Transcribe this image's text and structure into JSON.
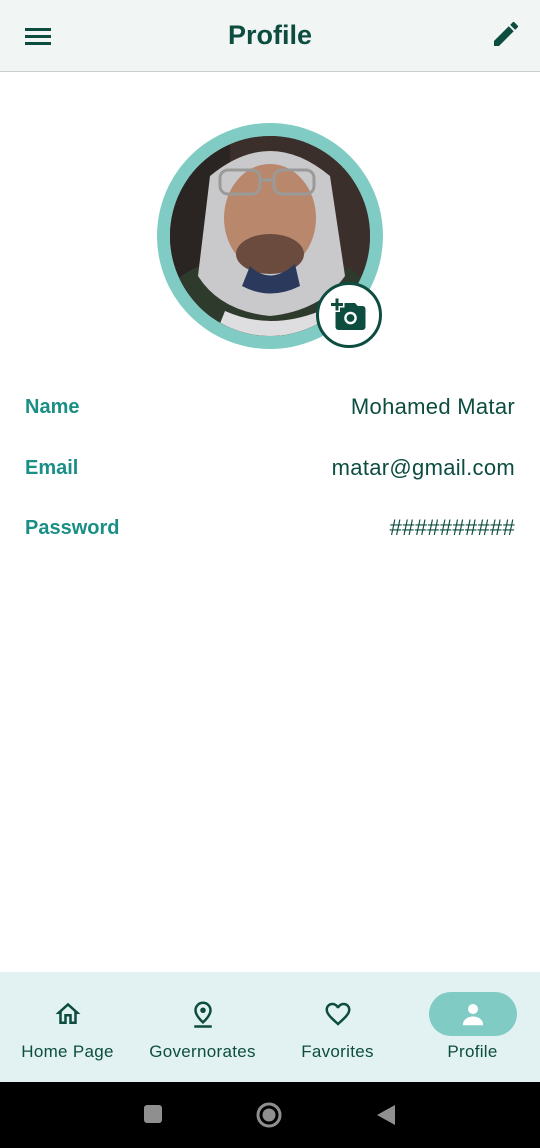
{
  "header": {
    "title": "Profile",
    "menu_icon": "menu-icon",
    "edit_icon": "pencil-icon"
  },
  "profile": {
    "avatar_icon": "avatar-photo",
    "camera_icon": "add-photo-camera-icon",
    "fields": [
      {
        "label": "Name",
        "value": "Mohamed Matar"
      },
      {
        "label": "Email",
        "value": "matar@gmail.com"
      },
      {
        "label": "Password",
        "value": "##########"
      }
    ]
  },
  "bottom_nav": {
    "items": [
      {
        "label": "Home Page",
        "icon": "home-icon",
        "active": false
      },
      {
        "label": "Governorates",
        "icon": "location-pin-icon",
        "active": false
      },
      {
        "label": "Favorites",
        "icon": "heart-icon",
        "active": false
      },
      {
        "label": "Profile",
        "icon": "person-icon",
        "active": true
      }
    ]
  },
  "system_nav": {
    "icons": [
      "recents-square-icon",
      "home-circle-icon",
      "back-triangle-icon"
    ]
  },
  "colors": {
    "primary_dark": "#0d4d40",
    "accent": "#1a8f85",
    "ring": "#80cbc4",
    "nav_background": "#e2f2f2",
    "appbar_background": "#f1f5f3"
  }
}
